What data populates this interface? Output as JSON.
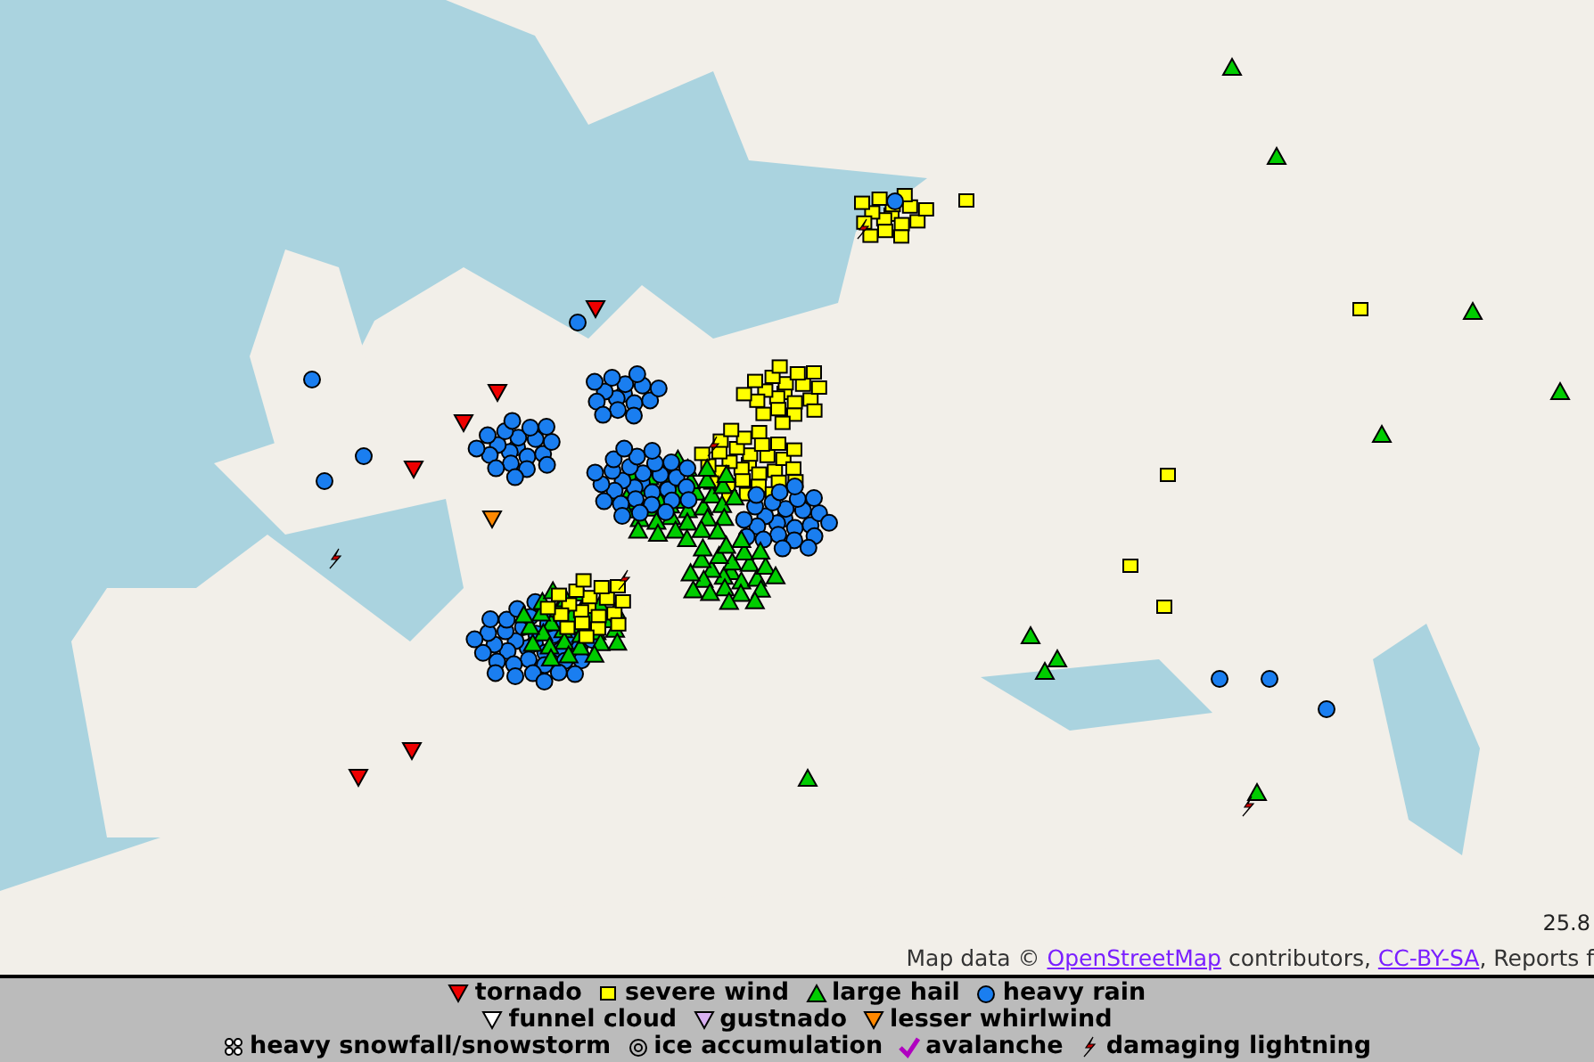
{
  "map": {
    "scale_reading": "25.8",
    "attribution": {
      "prefix": "Map data © ",
      "links": [
        {
          "text": "OpenStreetMap",
          "after": " contributors, "
        },
        {
          "text": "CC-BY-SA",
          "after": ", Reports f"
        }
      ]
    }
  },
  "legend": {
    "rows": [
      [
        {
          "kind": "tornado",
          "label": "tornado"
        },
        {
          "kind": "severe-wind",
          "label": "severe wind"
        },
        {
          "kind": "large-hail",
          "label": "large hail"
        },
        {
          "kind": "heavy-rain",
          "label": "heavy rain"
        }
      ],
      [
        {
          "kind": "funnel-cloud",
          "label": "funnel cloud"
        },
        {
          "kind": "gustnado",
          "label": "gustnado"
        },
        {
          "kind": "lesser-whirlwind",
          "label": "lesser whirlwind"
        }
      ],
      [
        {
          "kind": "snowfall",
          "label": "heavy snowfall/snowstorm"
        },
        {
          "kind": "ice",
          "label": "ice accumulation"
        },
        {
          "kind": "avalanche",
          "label": "avalanche"
        },
        {
          "kind": "lightning",
          "label": "damaging lightning"
        }
      ]
    ]
  }
}
